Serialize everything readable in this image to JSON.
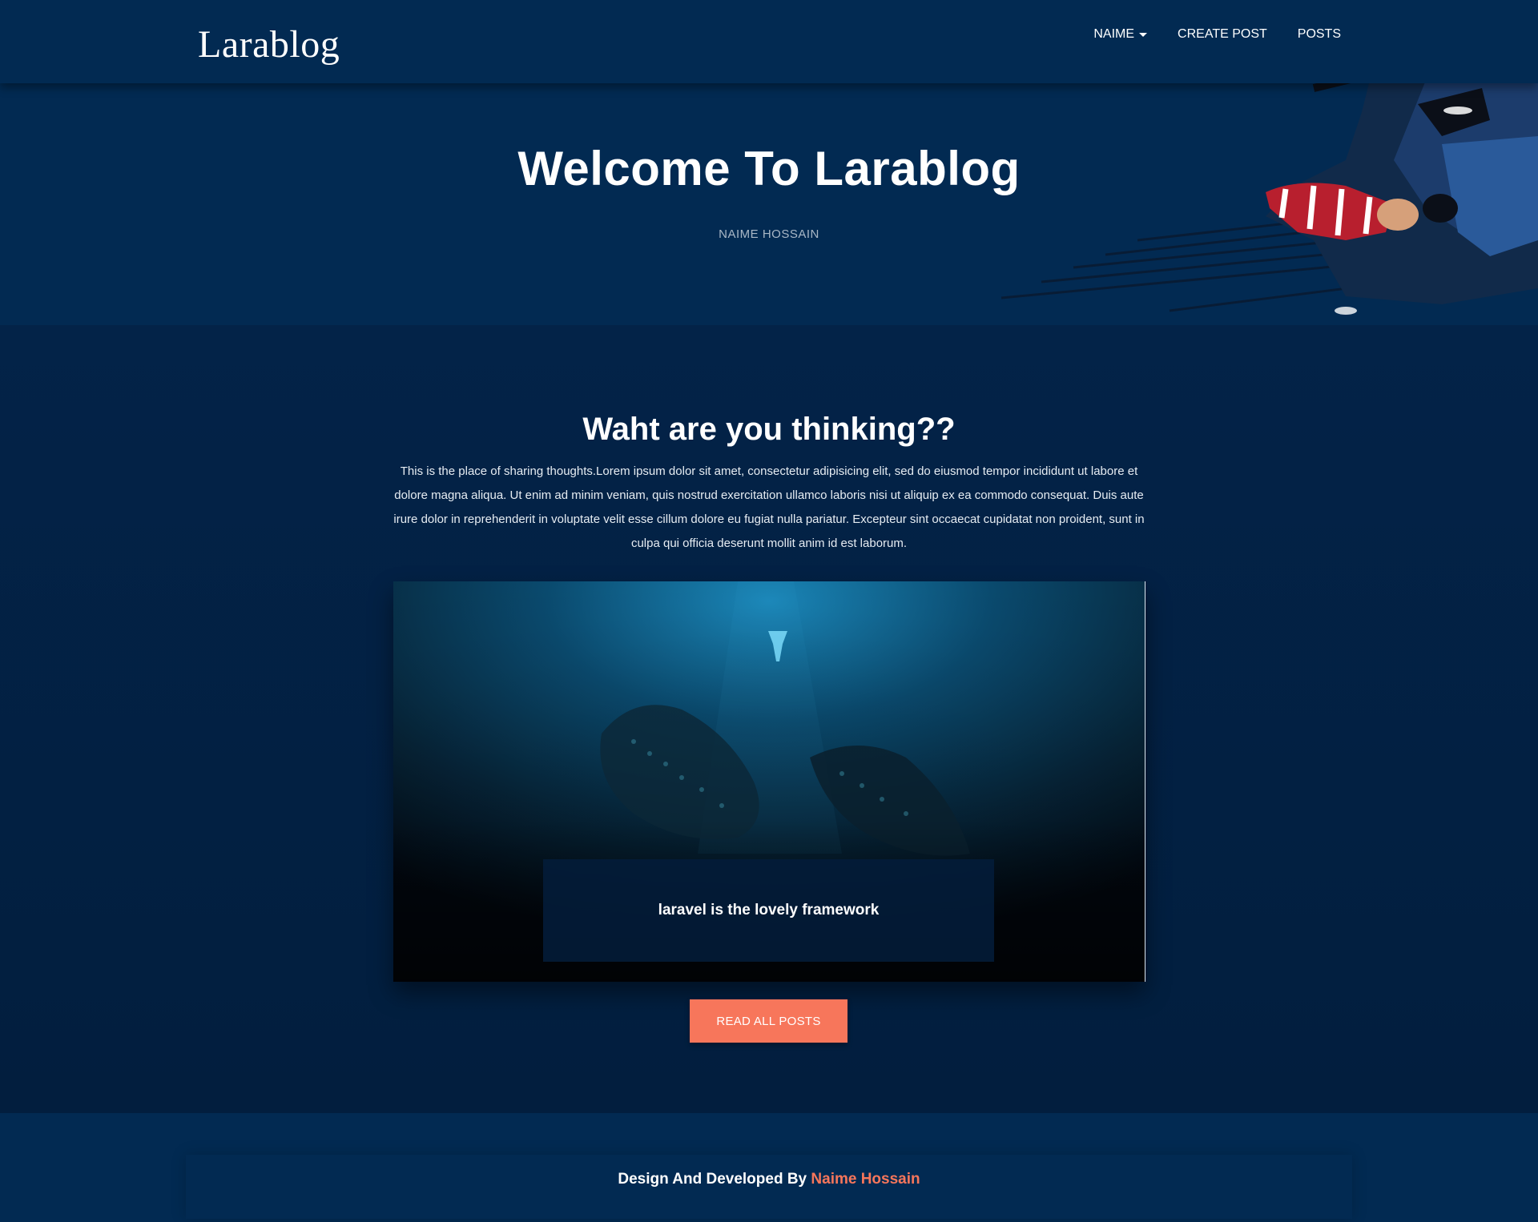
{
  "navbar": {
    "brand": "Larablog",
    "links": [
      {
        "label": "NAIME",
        "has_dropdown": true
      },
      {
        "label": "CREATE POST",
        "has_dropdown": false
      },
      {
        "label": "POSTS",
        "has_dropdown": false
      }
    ]
  },
  "hero": {
    "title": "Welcome To Larablog",
    "subtitle": "NAIME HOSSAIN",
    "art_icon": "ninja-illustration"
  },
  "main": {
    "heading": "Waht are you thinking??",
    "intro": "This is the place of sharing thoughts.Lorem ipsum dolor sit amet, consectetur adipisicing elit, sed do eiusmod tempor incididunt ut labore et dolore magna aliqua. Ut enim ad minim veniam, quis nostrud exercitation ullamco laboris nisi ut aliquip ex ea commodo consequat. Duis aute irure dolor in reprehenderit in voluptate velit esse cillum dolore eu fugiat nulla pariatur. Excepteur sint occaecat cupidatat non proident, sunt in culpa qui officia deserunt mollit anim id est laborum.",
    "post": {
      "caption": "laravel is the lovely framework",
      "image_icon": "deep-sea-creature-image"
    },
    "read_all_label": "READ ALL POSTS"
  },
  "footer": {
    "prefix": "Design And Developed By ",
    "author": "Naime Hossain"
  },
  "colors": {
    "background": "#022245",
    "navbar": "#022a52",
    "accent": "#f7765b",
    "text": "#ffffff"
  }
}
